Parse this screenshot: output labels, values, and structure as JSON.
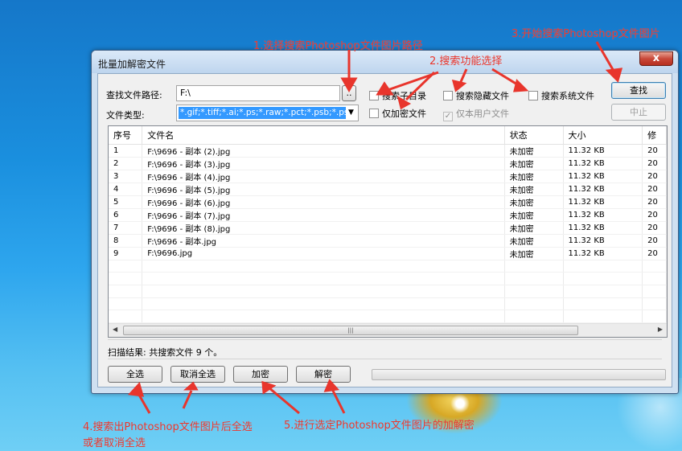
{
  "window": {
    "title": "批量加解密文件",
    "close_glyph": "x"
  },
  "form": {
    "path_label": "查找文件路径:",
    "path_value": "F:\\",
    "browse_label": "..",
    "type_label": "文件类型:",
    "type_value": "*.gif;*.tiff;*.ai;*.ps;*.raw;*.pct;*.psb;*.psd;",
    "search_button": "查找",
    "stop_button": "中止",
    "checkboxes": {
      "search_subdirs": {
        "label": "搜索子目录",
        "checked": false
      },
      "search_hidden": {
        "label": "搜索隐藏文件",
        "checked": false
      },
      "search_system": {
        "label": "搜索系统文件",
        "checked": false
      },
      "encrypted_only": {
        "label": "仅加密文件",
        "checked": false
      },
      "current_user_only": {
        "label": "仅本用户文件",
        "checked": true,
        "disabled": true
      }
    }
  },
  "table": {
    "columns": [
      "序号",
      "文件名",
      "状态",
      "大小",
      "修"
    ],
    "rows": [
      [
        "1",
        "F:\\9696 - 副本 (2).jpg",
        "未加密",
        "11.32 KB",
        "20"
      ],
      [
        "2",
        "F:\\9696 - 副本 (3).jpg",
        "未加密",
        "11.32 KB",
        "20"
      ],
      [
        "3",
        "F:\\9696 - 副本 (4).jpg",
        "未加密",
        "11.32 KB",
        "20"
      ],
      [
        "4",
        "F:\\9696 - 副本 (5).jpg",
        "未加密",
        "11.32 KB",
        "20"
      ],
      [
        "5",
        "F:\\9696 - 副本 (6).jpg",
        "未加密",
        "11.32 KB",
        "20"
      ],
      [
        "6",
        "F:\\9696 - 副本 (7).jpg",
        "未加密",
        "11.32 KB",
        "20"
      ],
      [
        "7",
        "F:\\9696 - 副本 (8).jpg",
        "未加密",
        "11.32 KB",
        "20"
      ],
      [
        "8",
        "F:\\9696 - 副本.jpg",
        "未加密",
        "11.32 KB",
        "20"
      ],
      [
        "9",
        "F:\\9696.jpg",
        "未加密",
        "11.32 KB",
        "20"
      ]
    ],
    "empty_rows": 7
  },
  "status_text": "扫描结果: 共搜索文件 9 个。",
  "bottom_buttons": {
    "select_all": "全选",
    "deselect_all": "取消全选",
    "encrypt": "加密",
    "decrypt": "解密"
  },
  "progress_value": 0,
  "annotations": {
    "a1": "1.选择搜索Photoshop文件图片路径",
    "a2": "2.搜索功能选择",
    "a3": "3.开始搜索Photoshop文件图片",
    "a4_line1": "4.搜索出Photoshop文件图片后全选",
    "a4_line2": "或者取消全选",
    "a5": "5.进行选定Photoshop文件图片的加解密"
  },
  "colors": {
    "annotation": "#e8352c",
    "selection": "#3399ff",
    "desktop": "#1a8fde"
  }
}
